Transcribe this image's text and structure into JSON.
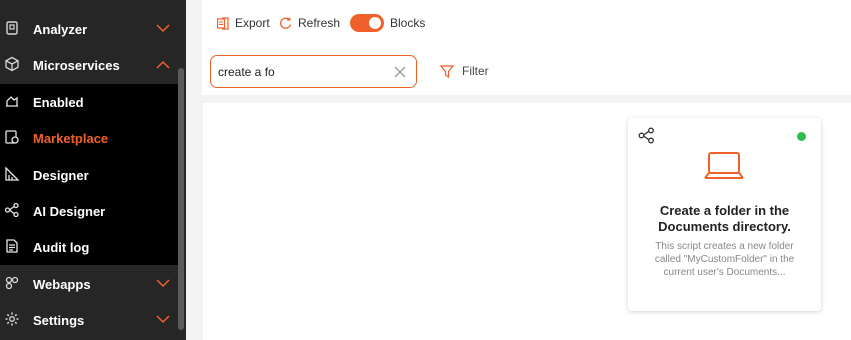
{
  "sidebar": {
    "items": [
      {
        "label": "Analyzer",
        "icon": "analyzer-icon"
      },
      {
        "label": "Microservices",
        "icon": "cube-icon"
      },
      {
        "label": "Webapps",
        "icon": "webapps-icon"
      },
      {
        "label": "Settings",
        "icon": "gear-icon"
      }
    ],
    "subitems": [
      {
        "label": "Enabled",
        "icon": "enabled-icon"
      },
      {
        "label": "Marketplace",
        "icon": "marketplace-icon",
        "active": true
      },
      {
        "label": "Designer",
        "icon": "designer-icon"
      },
      {
        "label": "AI Designer",
        "icon": "ai-designer-icon"
      },
      {
        "label": "Audit log",
        "icon": "audit-log-icon"
      }
    ]
  },
  "toolbar": {
    "export_label": "Export",
    "refresh_label": "Refresh",
    "blocks_label": "Blocks",
    "blocks_enabled": true
  },
  "search": {
    "value": "create a fo",
    "filter_label": "Filter"
  },
  "card": {
    "title": "Create a folder in the Documents directory.",
    "description": "This script creates a new folder called \"MyCustomFolder\" in the current user's Documents...",
    "status": "active",
    "status_color": "#2dbf4e"
  },
  "colors": {
    "accent": "#f0602a",
    "sidebar_bg": "#262626",
    "submenu_bg": "#000000"
  }
}
